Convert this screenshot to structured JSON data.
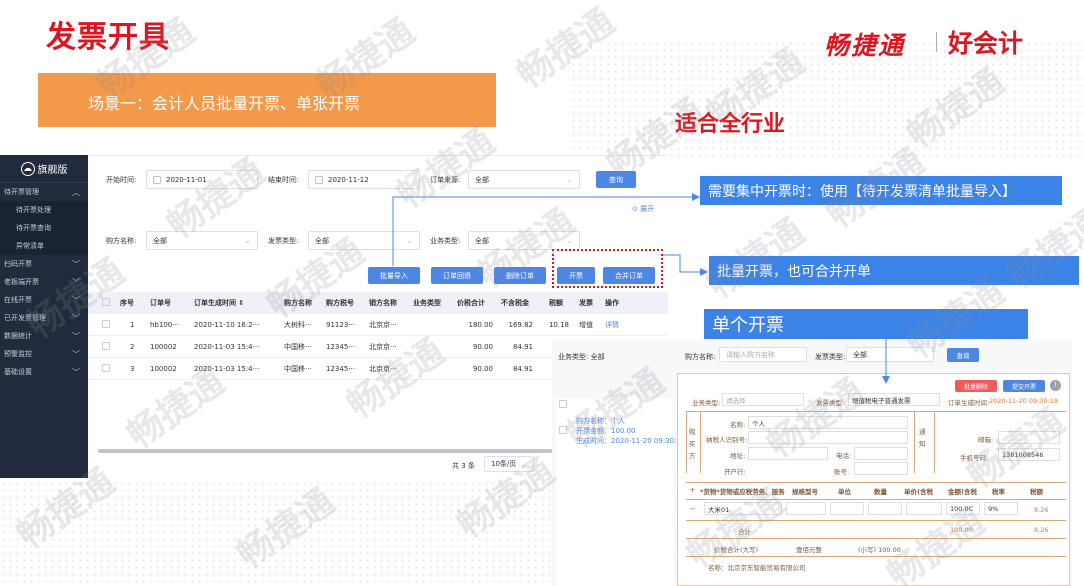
{
  "page": {
    "title": "发票开具",
    "brand": "畅捷通",
    "brand2": "好会计",
    "scene": "场景一：会计人员批量开票、单张开票",
    "all_industry": "适合全行业",
    "watermark": "畅捷通"
  },
  "callouts": {
    "batch_import": "需要集中开票时：使用【待开发票清单批量导入】",
    "batch_merge": "批量开票，也可合并开单",
    "single": "单个开票"
  },
  "sidebar": {
    "version": "旗舰版",
    "items": [
      {
        "label": "待开票管理",
        "chev": "︿"
      },
      {
        "label": "待开票处理",
        "sub": true
      },
      {
        "label": "待开票查询",
        "sub": true
      },
      {
        "label": "异常清单",
        "sub": true
      },
      {
        "label": "扫码开票",
        "chev": "﹀"
      },
      {
        "label": "老板端开票",
        "chev": "﹀"
      },
      {
        "label": "在线开票",
        "chev": "﹀"
      },
      {
        "label": "已开发票管理",
        "chev": "﹀"
      },
      {
        "label": "数据统计",
        "chev": "﹀"
      },
      {
        "label": "预警监控",
        "chev": "﹀"
      },
      {
        "label": "基础设置",
        "chev": "﹀"
      }
    ]
  },
  "filters": {
    "start_label": "开始时间:",
    "start_value": "2020-11-01",
    "end_label": "结束时间:",
    "end_value": "2020-11-12",
    "source_label": "订单来源:",
    "source_value": "全部",
    "query": "查询",
    "expand": "展开",
    "buyer_label": "购方名称:",
    "buyer_value": "全部",
    "invtype_label": "发票类型:",
    "invtype_value": "全部",
    "biztype_label": "业务类型:",
    "biztype_value": "全部"
  },
  "actions": {
    "import": "批量导入",
    "back": "订单回退",
    "delete": "删除订单",
    "issue": "开票",
    "merge": "合并订单"
  },
  "table": {
    "headers": [
      "序号",
      "订单号",
      "订单生成时间 ⇕",
      "购方名称",
      "购方税号",
      "销方名称",
      "业务类型",
      "价税合计",
      "不含税金",
      "税额",
      "发票",
      "操作"
    ],
    "rows": [
      [
        "1",
        "hb100···",
        "2020-11-10 16:2···",
        "大树科···",
        "91123···",
        "北京京···",
        "",
        "180.00",
        "169.82",
        "10.18",
        "增值",
        "详情"
      ],
      [
        "2",
        "100002",
        "2020-11-03 15:4···",
        "中国移···",
        "12345···",
        "北京京···",
        "",
        "90.00",
        "84.91",
        "",
        "",
        ""
      ],
      [
        "3",
        "100002",
        "2020-11-03 15:4···",
        "中国移···",
        "12345···",
        "北京京···",
        "",
        "90.00",
        "84.91",
        "",
        "",
        ""
      ]
    ],
    "total": "共 3 条",
    "pagesize": "10条/页"
  },
  "single": {
    "biztype_label": "业务类型:",
    "biztype_value": "全部",
    "buyer_label": "购方名称:",
    "buyer_placeholder": "请输入购方名称",
    "invtype_label": "发票类型:",
    "invtype_value": "全部",
    "query": "查询",
    "list_buyer": "购方名称：个人",
    "list_amount": "开票金额：100.00",
    "list_time": "生成时间：2020-11-20 09:30:19",
    "btn_delete": "批量删除",
    "btn_issue": "提交开票",
    "form_biz_label": "业务类型:",
    "form_biz_placeholder": "请选择",
    "form_inv_label": "发票类型:",
    "form_inv_value": "增值税电子普通发票",
    "form_time_label": "订单生成时间:",
    "form_time_value": "2020-11-20 09:30:19",
    "buyer_side": "购买方",
    "name_label": "名称:",
    "name_value": "个人",
    "taxid_label": "纳税人识别号:",
    "addr_label": "地址:",
    "tel_label": "电话:",
    "bank_label": "开户行:",
    "acct_label": "账号:",
    "notify_side": "通知",
    "email_label": "邮箱:",
    "phone_label": "手机号码:",
    "phone_value": "1381008546",
    "item_headers": [
      "*货物*货物或应税劳务、服务",
      "规格型号",
      "单位",
      "数量",
      "单价(含税",
      "金额(含税",
      "税率",
      "税额"
    ],
    "item_name": "大米01",
    "item_amount": "100.0C",
    "item_rate": "9%",
    "item_tax": "8.26",
    "subtotal_label": "合计",
    "subtotal_amount": "100.00",
    "subtotal_tax": "8.26",
    "total_label": "价税合计(大写)",
    "total_cn": "壹佰元整",
    "total_small": "(小写) 100.00",
    "seller_name": "名称：北京京东智能贸易有限公司"
  }
}
